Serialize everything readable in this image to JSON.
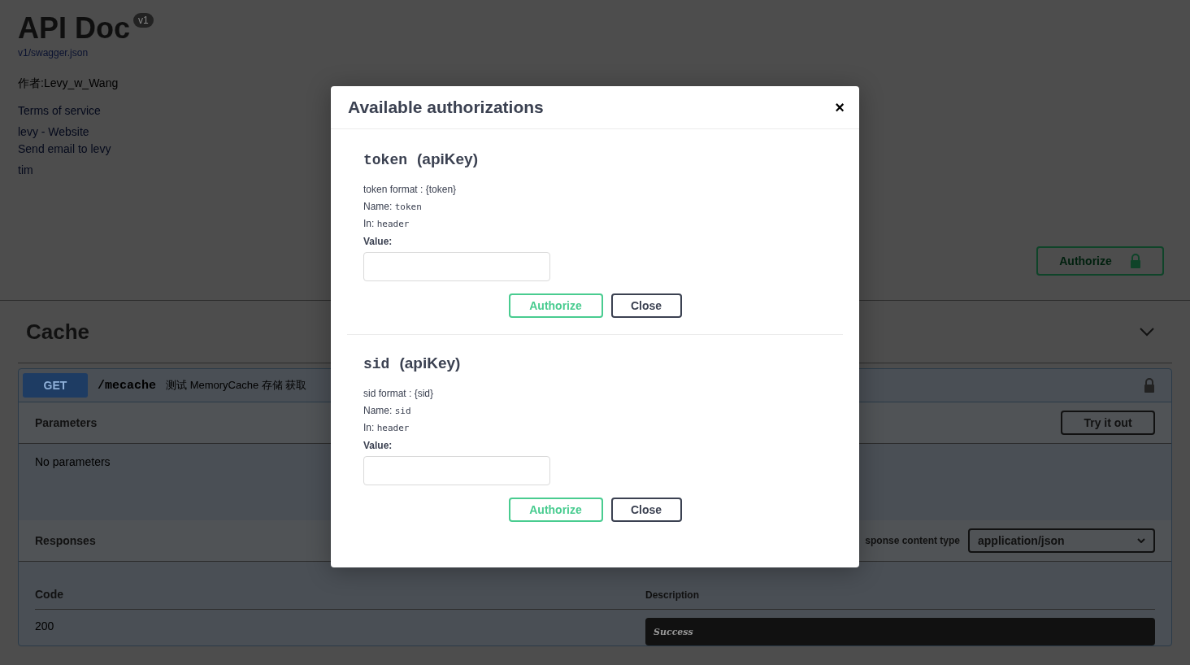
{
  "info": {
    "title": "API Doc",
    "version": "v1",
    "spec_url": "v1/swagger.json",
    "author": "作者:Levy_w_Wang",
    "links": [
      "Terms of service",
      "levy - Website",
      "Send email to levy",
      "tim"
    ]
  },
  "authorize_button": {
    "label": "Authorize"
  },
  "tag": {
    "name": "Cache",
    "expanded": true
  },
  "operation": {
    "method": "GET",
    "path": "/mecache",
    "summary": "测试 MemoryCache 存储 获取",
    "parameters_title": "Parameters",
    "try_button": "Try it out",
    "no_params": "No parameters",
    "responses_title": "Responses",
    "content_type_label": "sponse content type",
    "content_type": "application/json",
    "columns": [
      "Code",
      "Description"
    ],
    "rows": [
      {
        "code": "200",
        "description": "Success"
      }
    ]
  },
  "modal": {
    "title": "Available authorizations",
    "close": "×",
    "schemes": [
      {
        "name": "token",
        "type": "(apiKey)",
        "format": "token format : {token}",
        "name_label": "Name:",
        "name_value": "token",
        "in_label": "In:",
        "in_value": "header",
        "value_label": "Value:",
        "buttons": [
          "Authorize",
          "Close"
        ]
      },
      {
        "name": "sid",
        "type": "(apiKey)",
        "format": "sid format : {sid}",
        "name_label": "Name:",
        "name_value": "sid",
        "in_label": "In:",
        "in_value": "header",
        "value_label": "Value:",
        "buttons": [
          "Authorize",
          "Close"
        ]
      }
    ]
  }
}
